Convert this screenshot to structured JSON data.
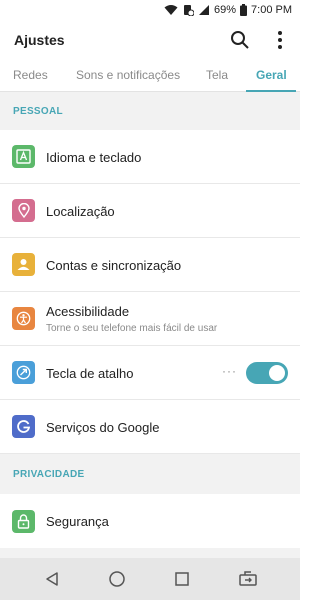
{
  "status": {
    "battery": "69%",
    "time": "7:00 PM"
  },
  "app": {
    "title": "Ajustes"
  },
  "tabs": [
    {
      "label": "Redes",
      "active": false
    },
    {
      "label": "Sons e notificações",
      "active": false
    },
    {
      "label": "Tela",
      "active": false
    },
    {
      "label": "Geral",
      "active": true
    }
  ],
  "sections": [
    {
      "title": "PESSOAL",
      "items": [
        {
          "label": "Idioma e teclado",
          "icon": "language-icon",
          "color": "#5cb86a"
        },
        {
          "label": "Localização",
          "icon": "location-pin-icon",
          "color": "#d46d8f"
        },
        {
          "label": "Contas e sincronização",
          "icon": "account-sync-icon",
          "color": "#e8b13a"
        },
        {
          "label": "Acessibilidade",
          "sublabel": "Torne o seu telefone mais fácil de usar",
          "icon": "accessibility-icon",
          "color": "#e88640"
        },
        {
          "label": "Tecla de atalho",
          "icon": "shortcut-key-icon",
          "color": "#4a9fd9",
          "toggle": true,
          "more": "···"
        },
        {
          "label": "Serviços do Google",
          "icon": "google-g-icon",
          "color": "#4f6cc9"
        }
      ]
    },
    {
      "title": "PRIVACIDADE",
      "items": [
        {
          "label": "Segurança",
          "icon": "lock-icon",
          "color": "#5cb86a"
        }
      ]
    }
  ],
  "colors": {
    "accent": "#47a6b5",
    "background": "#f2f2f2"
  }
}
